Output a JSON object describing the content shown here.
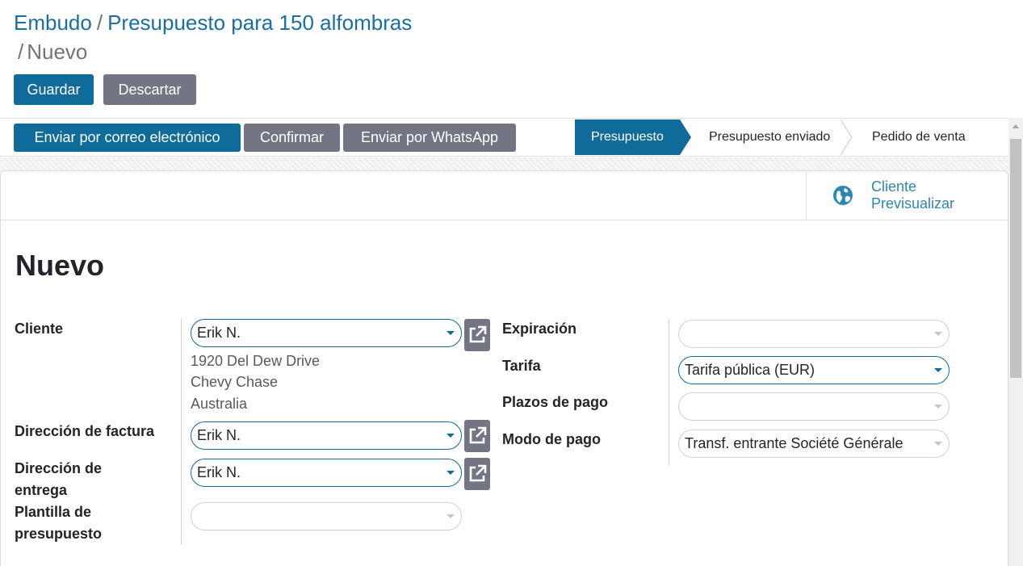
{
  "breadcrumb": {
    "root": "Embudo",
    "sep": "/",
    "parent": "Presupuesto para 150 alfombras",
    "current": "Nuevo"
  },
  "control": {
    "save_label": "Guardar",
    "discard_label": "Descartar"
  },
  "statusbar": {
    "buttons": [
      {
        "label": "Enviar por correo electrónico",
        "style": "primary"
      },
      {
        "label": "Confirmar",
        "style": "secondary"
      },
      {
        "label": "Enviar por WhatsApp",
        "style": "secondary"
      }
    ],
    "stages": [
      {
        "label": "Presupuesto",
        "active": true
      },
      {
        "label": "Presupuesto enviado",
        "active": false
      },
      {
        "label": "Pedido de venta",
        "active": false
      }
    ]
  },
  "smart_button": {
    "icon": "globe-icon",
    "line1": "Cliente",
    "line2": "Previsualizar"
  },
  "form": {
    "title": "Nuevo",
    "left": {
      "customer_label": "Cliente",
      "customer_value": "Erik N.",
      "address_lines": [
        "1920 Del Dew Drive",
        "Chevy Chase",
        "Australia"
      ],
      "invoice_label": "Dirección de factura",
      "invoice_value": "Erik N.",
      "delivery_label_1": "Dirección de",
      "delivery_label_2": "entrega",
      "delivery_value": "Erik N.",
      "template_label_1": "Plantilla de",
      "template_label_2": "presupuesto",
      "template_value": ""
    },
    "right": {
      "expiration_label": "Expiración",
      "expiration_value": "",
      "pricelist_label": "Tarifa",
      "pricelist_value": "Tarifa pública (EUR)",
      "payment_terms_label": "Plazos de pago",
      "payment_terms_value": "",
      "payment_mode_label": "Modo de pago",
      "payment_mode_value": "Transf. entrante Société Générale"
    }
  },
  "colors": {
    "primary": "#0e6b9a",
    "secondary": "#737585",
    "link": "#1a6fa0"
  }
}
